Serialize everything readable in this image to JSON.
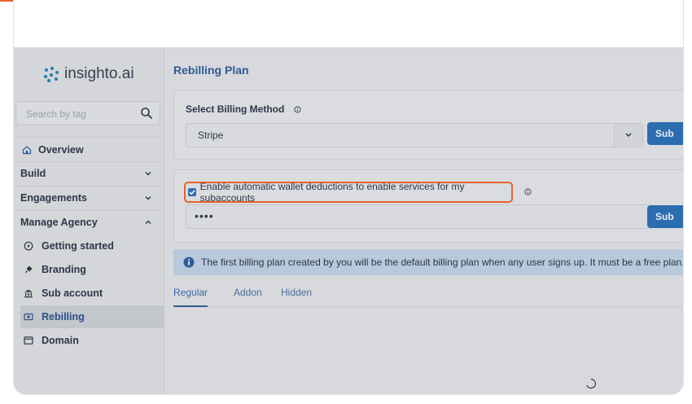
{
  "sidebar": {
    "logo_text": "insighto.ai",
    "search_placeholder": "Search by tag",
    "overview_label": "Overview",
    "sections": [
      {
        "label": "Build"
      },
      {
        "label": "Engagements"
      },
      {
        "label": "Manage Agency"
      }
    ],
    "agency_items": [
      {
        "label": "Getting started",
        "icon": "play-circle-icon"
      },
      {
        "label": "Branding",
        "icon": "brush-icon"
      },
      {
        "label": "Sub account",
        "icon": "bank-icon"
      },
      {
        "label": "Rebilling",
        "icon": "billing-icon",
        "active": true
      },
      {
        "label": "Domain",
        "icon": "window-icon"
      }
    ]
  },
  "main": {
    "title": "Rebilling Plan",
    "billing": {
      "label": "Select Billing Method",
      "selected": "Stripe",
      "submit_label": "Sub"
    },
    "wallet": {
      "checkbox_label": "Enable automatic wallet deductions to enable services for my subaccounts",
      "checked": true,
      "masked_value": "••••",
      "submit_label": "Sub"
    },
    "alert_text": "The first billing plan created by you will be the default billing plan when any user signs up. It must be a free plan.",
    "tabs": [
      {
        "label": "Regular",
        "active": true
      },
      {
        "label": "Addon"
      },
      {
        "label": "Hidden"
      }
    ]
  },
  "colors": {
    "accent": "#e8622d",
    "primary": "#2c6db0",
    "title": "#2f5a95"
  }
}
